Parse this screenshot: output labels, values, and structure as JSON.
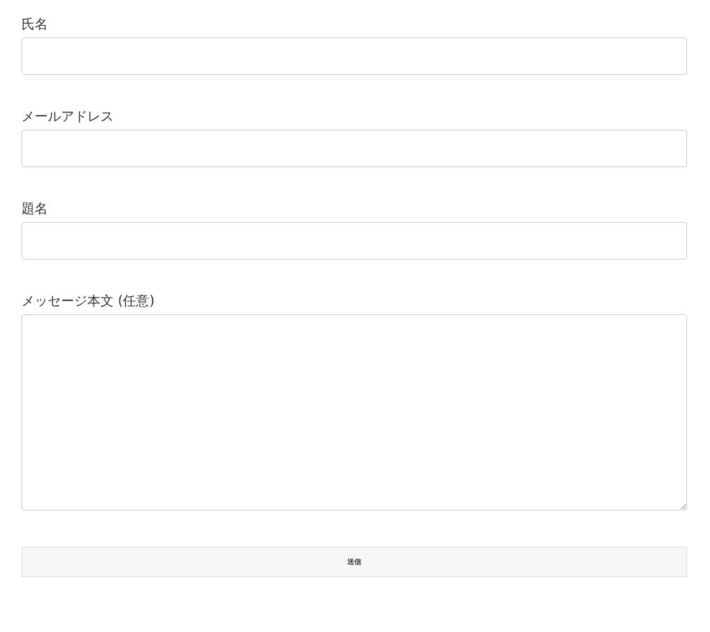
{
  "fields": [
    {
      "label": "氏名",
      "kind": "input"
    },
    {
      "label": "メールアドレス",
      "kind": "input"
    },
    {
      "label": "題名",
      "kind": "input"
    },
    {
      "label": "メッセージ本文 (任意)",
      "kind": "textarea"
    }
  ],
  "submit": {
    "label": "送信"
  }
}
